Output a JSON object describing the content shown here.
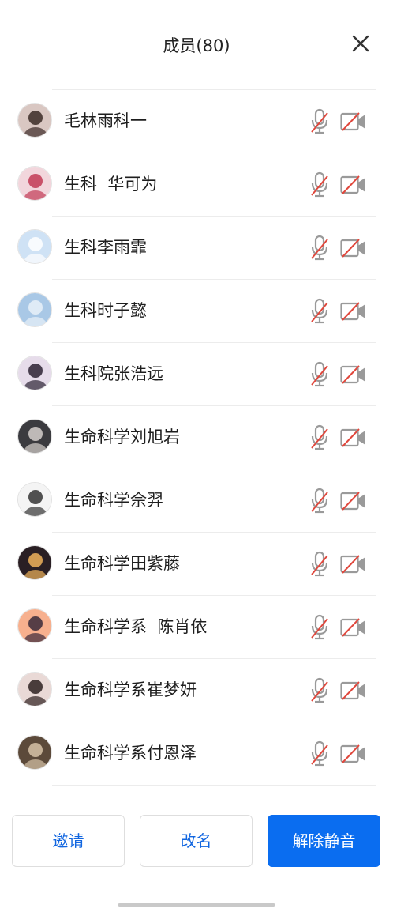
{
  "header": {
    "title": "成员(80)"
  },
  "members": [
    {
      "name": "毛林雨科一",
      "avatar_bg": "#d9c7c2",
      "avatar_fg": "#3a2a26"
    },
    {
      "name": "生科  华可为",
      "avatar_bg": "#f2d6dc",
      "avatar_fg": "#c23a55"
    },
    {
      "name": "生科李雨霏",
      "avatar_bg": "#cfe2f5",
      "avatar_fg": "#ffffff"
    },
    {
      "name": "生科时子懿",
      "avatar_bg": "#a9c8e6",
      "avatar_fg": "#e9f1f8"
    },
    {
      "name": "生科院张浩远",
      "avatar_bg": "#e6dcea",
      "avatar_fg": "#2b2233"
    },
    {
      "name": "生命科学刘旭岩",
      "avatar_bg": "#3b3b3f",
      "avatar_fg": "#d6d0cc"
    },
    {
      "name": "生命科学佘羿",
      "avatar_bg": "#f4f4f4",
      "avatar_fg": "#333333"
    },
    {
      "name": "生命科学田紫藤",
      "avatar_bg": "#2a1f24",
      "avatar_fg": "#f0b35c"
    },
    {
      "name": "生命科学系  陈肖依",
      "avatar_bg": "#f7b08e",
      "avatar_fg": "#3a2a3a"
    },
    {
      "name": "生命科学系崔梦妍",
      "avatar_bg": "#e9d9d6",
      "avatar_fg": "#2d2020"
    },
    {
      "name": "生命科学系付恩泽",
      "avatar_bg": "#5c4a3a",
      "avatar_fg": "#d7c3a8"
    }
  ],
  "buttons": {
    "invite": "邀请",
    "rename": "改名",
    "unmute_all": "解除静音"
  },
  "colors": {
    "accent": "#0a6df0",
    "muted_slash": "#e0473c",
    "icon_gray": "#9a9a9a"
  },
  "icons": {
    "close": "close-icon",
    "mic": "mic-muted-icon",
    "camera": "camera-off-icon"
  }
}
